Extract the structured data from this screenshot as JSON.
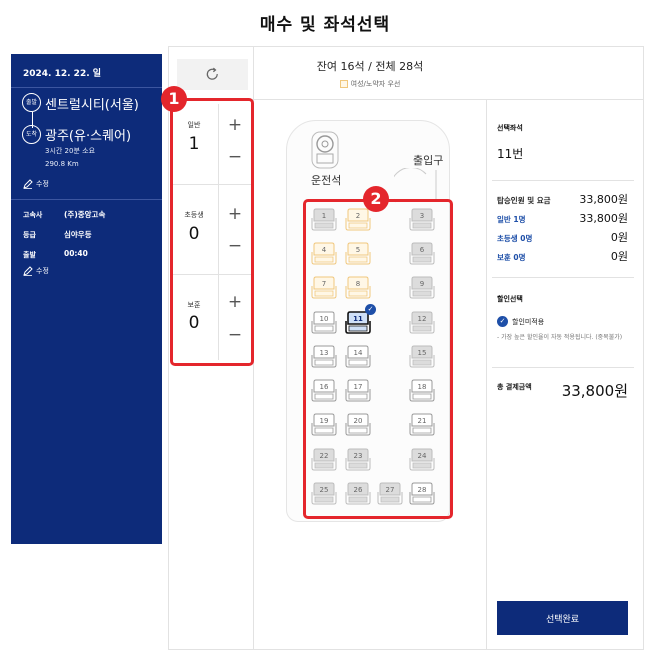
{
  "page_title": "매수 및 좌석선택",
  "trip": {
    "date": "2024. 12. 22. 일",
    "departure_badge": "출발",
    "departure": "센트럴시티(서울)",
    "arrival_badge": "도착",
    "arrival": "광주(유·스퀘어)",
    "duration": "3시간 20분 소요",
    "distance": "290.8 Km",
    "edit_label": "수정",
    "company_label": "고속사",
    "company": "(주)중앙고속",
    "grade_label": "등급",
    "grade": "심야우등",
    "depart_time_label": "출발",
    "depart_time": "00:40",
    "edit_label_2": "수정"
  },
  "passengers": [
    {
      "label": "일반",
      "count": "1"
    },
    {
      "label": "초등생",
      "count": "0"
    },
    {
      "label": "보훈",
      "count": "0"
    }
  ],
  "stepper": {
    "plus": "+",
    "minus": "−"
  },
  "callouts": {
    "one": "1",
    "two": "2"
  },
  "seat_header": {
    "remaining": "잔여 16석 / 전체 28석",
    "legend": "여성/노약자 우선"
  },
  "bus": {
    "driver": "운전석",
    "exit": "출입구"
  },
  "seats": [
    {
      "n": "1",
      "status": "taken"
    },
    {
      "n": "2",
      "status": "priority"
    },
    {
      "n": "3",
      "status": "taken"
    },
    {
      "n": "4",
      "status": "priority"
    },
    {
      "n": "5",
      "status": "priority"
    },
    {
      "n": "6",
      "status": "taken"
    },
    {
      "n": "7",
      "status": "priority"
    },
    {
      "n": "8",
      "status": "priority"
    },
    {
      "n": "9",
      "status": "taken"
    },
    {
      "n": "10",
      "status": "available"
    },
    {
      "n": "11",
      "status": "selected"
    },
    {
      "n": "12",
      "status": "taken"
    },
    {
      "n": "13",
      "status": "available"
    },
    {
      "n": "14",
      "status": "available"
    },
    {
      "n": "15",
      "status": "taken"
    },
    {
      "n": "16",
      "status": "available"
    },
    {
      "n": "17",
      "status": "available"
    },
    {
      "n": "18",
      "status": "available"
    },
    {
      "n": "19",
      "status": "available"
    },
    {
      "n": "20",
      "status": "available"
    },
    {
      "n": "21",
      "status": "available"
    },
    {
      "n": "22",
      "status": "taken"
    },
    {
      "n": "23",
      "status": "taken"
    },
    {
      "n": "24",
      "status": "taken"
    },
    {
      "n": "25",
      "status": "taken"
    },
    {
      "n": "26",
      "status": "taken"
    },
    {
      "n": "27",
      "status": "taken"
    },
    {
      "n": "28",
      "status": "available"
    }
  ],
  "summary": {
    "selected_seat_label": "선택좌석",
    "selected_seat": "11번",
    "fare_label": "탑승인원 및 요금",
    "fare_total": "33,800원",
    "rows": [
      {
        "label": "일반 1명",
        "value": "33,800원"
      },
      {
        "label": "초등생 0명",
        "value": "0원"
      },
      {
        "label": "보훈 0명",
        "value": "0원"
      }
    ],
    "discount_label": "할인선택",
    "discount_option": "할인미적용",
    "discount_note": "- 가장 높은 할인율이 자동 적용됩니다. (중복불가)",
    "total_label": "총 결제금액",
    "total": "33,800원",
    "complete_button": "선택완료"
  },
  "colors": {
    "navy": "#0d2b7a",
    "accent_blue": "#1e4fa8",
    "callout_red": "#e4262c",
    "priority_seat": "#f0c77d",
    "taken_seat": "#dcdcdc"
  }
}
